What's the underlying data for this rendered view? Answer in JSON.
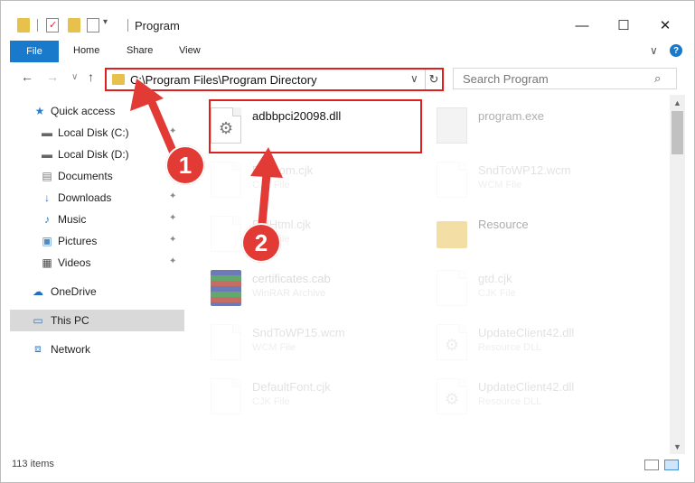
{
  "window": {
    "title": "Program",
    "controls": {
      "minimize": "—",
      "maximize": "☐",
      "close": "✕"
    }
  },
  "ribbon": {
    "tabs": [
      "File",
      "Home",
      "Share",
      "View"
    ],
    "expand": "∨",
    "help": "?"
  },
  "nav": {
    "back": "←",
    "forward": "→",
    "recent": "∨",
    "up": "↑",
    "address": "C:\\Program Files\\Program Directory",
    "dropdown": "∨",
    "refresh": "↻",
    "search_placeholder": "Search Program",
    "search_icon": "⌕"
  },
  "sidebar": {
    "items": [
      {
        "label": "Quick access",
        "icon": "★"
      },
      {
        "label": "Local Disk (C:)",
        "icon": "▬"
      },
      {
        "label": "Local Disk (D:)",
        "icon": "▬"
      },
      {
        "label": "Documents",
        "icon": "▤"
      },
      {
        "label": "Downloads",
        "icon": "↓"
      },
      {
        "label": "Music",
        "icon": "♪"
      },
      {
        "label": "Pictures",
        "icon": "▣"
      },
      {
        "label": "Videos",
        "icon": "▦"
      },
      {
        "label": "OneDrive",
        "icon": "☁"
      },
      {
        "label": "This PC",
        "icon": "▭"
      },
      {
        "label": "Network",
        "icon": "⧈"
      }
    ],
    "pin_icon": "📌"
  },
  "files": [
    {
      "name": "adbbpci20098.dll",
      "type": "",
      "icon": "dll"
    },
    {
      "name": "program.exe",
      "type": "",
      "icon": "exe"
    },
    {
      "name": "EraCom.cjk",
      "type": "CJK File",
      "icon": "doc"
    },
    {
      "name": "SndToWP12.wcm",
      "type": "WCM File",
      "icon": "doc"
    },
    {
      "name": "FtdHtml.cjk",
      "type": "CJK File",
      "icon": "doc"
    },
    {
      "name": "Resource",
      "type": "",
      "icon": "folder"
    },
    {
      "name": "certificates.cab",
      "type": "WinRAR Archive",
      "icon": "rar"
    },
    {
      "name": "gtd.cjk",
      "type": "CJK File",
      "icon": "doc"
    },
    {
      "name": "SndToWP15.wcm",
      "type": "WCM File",
      "icon": "doc"
    },
    {
      "name": "UpdateClient42.dll",
      "type": "Resource DLL",
      "icon": "dll"
    },
    {
      "name": "DefaultFont.cjk",
      "type": "CJK File",
      "icon": "doc"
    },
    {
      "name": "UpdateClient42.dll",
      "type": "Resource DLL",
      "icon": "dll"
    }
  ],
  "status": {
    "count": "113 items"
  },
  "annotations": {
    "step1": "1",
    "step2": "2",
    "color": "#e23b36"
  }
}
